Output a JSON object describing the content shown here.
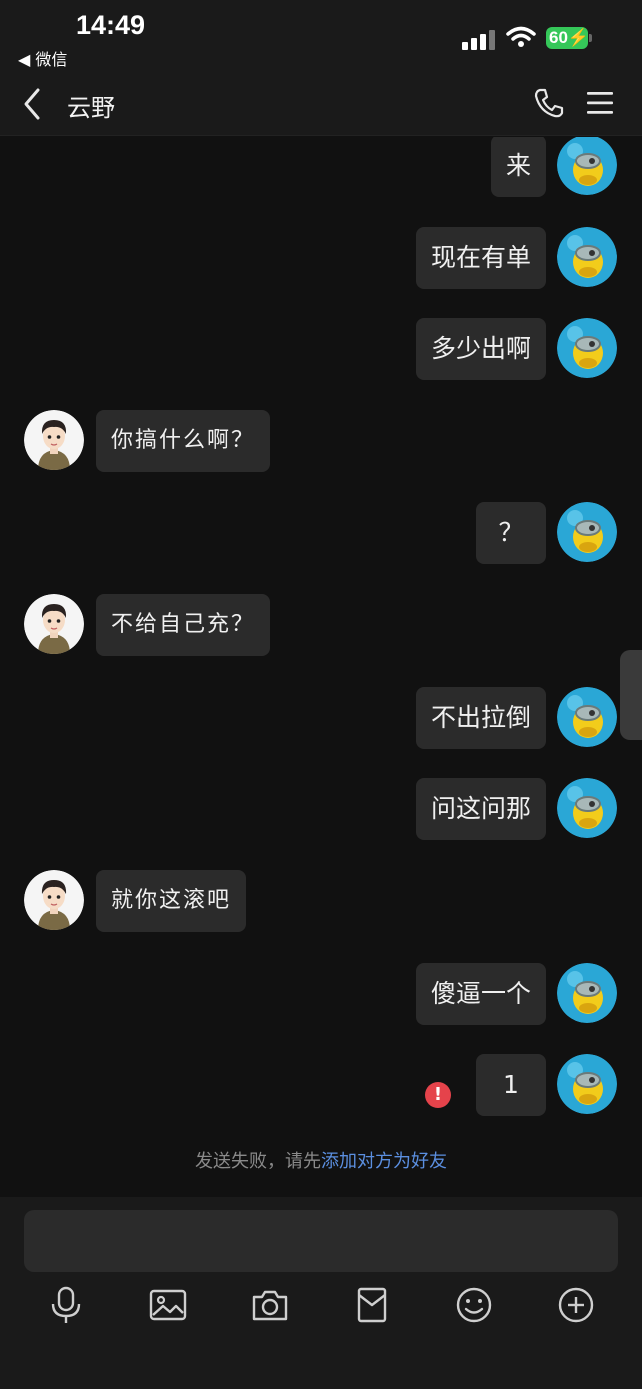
{
  "status_bar": {
    "time": "14:49",
    "back_app": "◀ 微信",
    "battery": "60"
  },
  "nav": {
    "title": "云野"
  },
  "messages": [
    {
      "side": "out",
      "text": "来"
    },
    {
      "side": "out",
      "text": "现在有单"
    },
    {
      "side": "out",
      "text": "多少出啊"
    },
    {
      "side": "in",
      "text": "你搞什么啊？"
    },
    {
      "side": "out",
      "text": "？"
    },
    {
      "side": "in",
      "text": "不给自己充？"
    },
    {
      "side": "out",
      "text": "不出拉倒"
    },
    {
      "side": "out",
      "text": "问这问那"
    },
    {
      "side": "in",
      "text": "就你这滚吧"
    },
    {
      "side": "out",
      "text": "傻逼一个"
    },
    {
      "side": "out",
      "text": "1",
      "failed": true
    }
  ],
  "system_note": {
    "prefix": "发送失败，请先",
    "link": "添加对方为好友"
  },
  "fail_mark": "!",
  "colors": {
    "background": "#111111",
    "bubble": "#2b2b2b",
    "link": "#5b8fe0",
    "error": "#e5434b",
    "battery": "#35c759"
  },
  "toolbar_icons": [
    "microphone-icon",
    "image-icon",
    "camera-icon",
    "red-packet-icon",
    "emoji-icon",
    "plus-icon"
  ]
}
